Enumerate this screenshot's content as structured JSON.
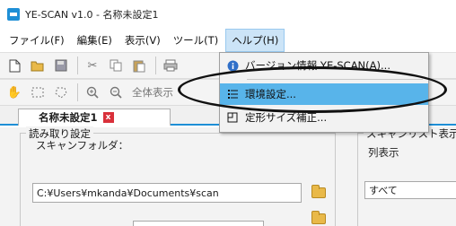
{
  "window": {
    "title": "YE-SCAN v1.0 - 名称未設定1"
  },
  "menubar": {
    "items": [
      {
        "label": "ファイル(F)"
      },
      {
        "label": "編集(E)"
      },
      {
        "label": "表示(V)"
      },
      {
        "label": "ツール(T)"
      },
      {
        "label": "ヘルプ(H)"
      }
    ]
  },
  "toolbar2": {
    "fit_all_label": "全体表示"
  },
  "tab": {
    "label": "名称未設定1",
    "close_glyph": "x"
  },
  "scan_settings": {
    "group_title": "読み取り設定",
    "folder_label": "スキャンフォルダ：",
    "folder_value": "C:¥Users¥mkanda¥Documents¥scan"
  },
  "scan_list": {
    "group_title": "スキャンリスト表示",
    "column_label": "列表示",
    "column_value": "すべて"
  },
  "help_menu": {
    "items": [
      {
        "label": "バージョン情報 YE-SCAN(A)...",
        "icon": "info-icon"
      },
      {
        "label": "環境設定...",
        "icon": "settings-icon",
        "highlighted": true
      },
      {
        "label": "定形サイズ補正...",
        "icon": "size-icon"
      }
    ]
  },
  "colors": {
    "accent": "#1e8fd6",
    "highlight": "#58b4ea",
    "close": "#d9303a"
  }
}
